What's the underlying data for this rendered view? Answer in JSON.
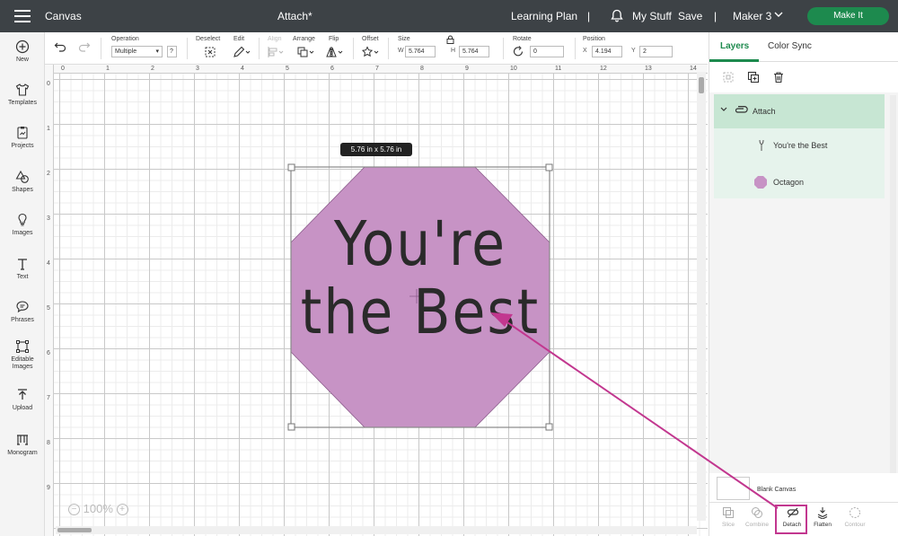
{
  "topbar": {
    "app_name": "Canvas",
    "project_title": "Attach*",
    "learning_plan": "Learning Plan",
    "separator": "|",
    "my_stuff": "My Stuff",
    "save": "Save",
    "machine": "Maker 3",
    "make_it": "Make It"
  },
  "sidebar": {
    "items": [
      {
        "label": "New",
        "icon": "plus-circle-icon"
      },
      {
        "label": "Templates",
        "icon": "shirt-icon"
      },
      {
        "label": "Projects",
        "icon": "projects-icon"
      },
      {
        "label": "Shapes",
        "icon": "shapes-icon"
      },
      {
        "label": "Images",
        "icon": "lightbulb-icon"
      },
      {
        "label": "Text",
        "icon": "text-icon"
      },
      {
        "label": "Phrases",
        "icon": "speech-bubble-icon"
      },
      {
        "label": "Editable",
        "label2": "Images",
        "icon": "editable-images-icon"
      },
      {
        "label": "Upload",
        "icon": "upload-icon"
      },
      {
        "label": "Monogram",
        "icon": "monogram-icon"
      }
    ]
  },
  "toolbar": {
    "operation_label": "Operation",
    "operation_value": "Multiple",
    "help": "?",
    "deselect_label": "Deselect",
    "edit_label": "Edit",
    "align_label": "Align",
    "arrange_label": "Arrange",
    "flip_label": "Flip",
    "offset_label": "Offset",
    "size_label": "Size",
    "w_label": "W",
    "w_value": "5.764",
    "h_label": "H",
    "h_value": "5.764",
    "rotate_label": "Rotate",
    "rotate_value": "0",
    "position_label": "Position",
    "x_label": "X",
    "x_value": "4.194",
    "y_label": "Y",
    "y_value": "2"
  },
  "canvas": {
    "ruler_top": [
      "0",
      "1",
      "2",
      "3",
      "4",
      "5",
      "6",
      "7",
      "8",
      "9",
      "10",
      "11",
      "12",
      "13",
      "14"
    ],
    "ruler_left": [
      "0",
      "1",
      "2",
      "3",
      "4",
      "5",
      "6",
      "7",
      "8",
      "9"
    ],
    "size_badge": "5.76  in x 5.76  in",
    "design_line1": "You're",
    "design_line2": "the Best",
    "zoom_minus": "−",
    "zoom_value": "100%",
    "zoom_plus": "+",
    "colors": {
      "octagon_fill": "#c793c5",
      "octagon_stroke": "#8a5a8a",
      "annotation_arrow": "#c2378f"
    }
  },
  "right_panel": {
    "tabs": [
      "Layers",
      "Color Sync"
    ],
    "layers": {
      "group_name": "Attach",
      "children": [
        {
          "name": "You're the Best",
          "icon": "text-layer-icon"
        },
        {
          "name": "Octagon",
          "icon": "octagon-swatch-icon",
          "color": "#c793c5"
        }
      ]
    },
    "blank_canvas": "Blank Canvas",
    "actions": [
      {
        "label": "Slice",
        "enabled": false
      },
      {
        "label": "Combine",
        "enabled": false
      },
      {
        "label": "Detach",
        "enabled": true
      },
      {
        "label": "Flatten",
        "enabled": true
      },
      {
        "label": "Contour",
        "enabled": false
      }
    ]
  },
  "accent_color": "#1d8a4e"
}
